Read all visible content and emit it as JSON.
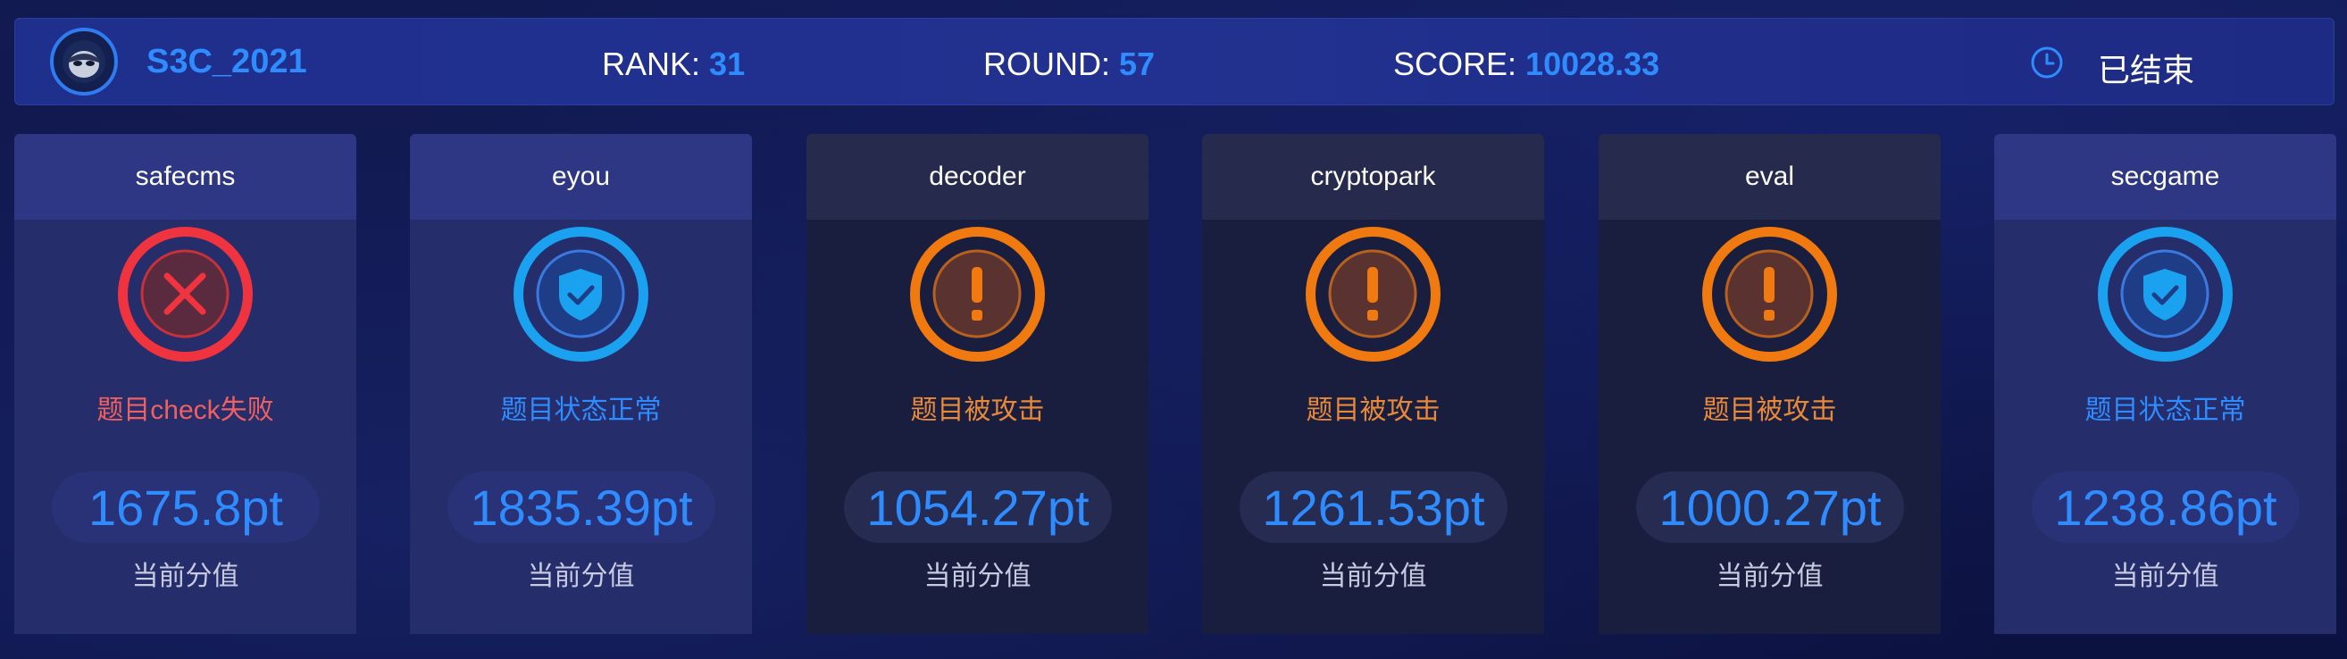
{
  "header": {
    "team_name": "S3C_2021",
    "rank_label": "RANK:",
    "rank_value": "31",
    "round_label": "ROUND:",
    "round_value": "57",
    "score_label": "SCORE:",
    "score_value": "10028.33",
    "status_icon": "clock-icon",
    "status_text": "已结束"
  },
  "score_caption": "当前分值",
  "colors": {
    "accent": "#2f8cff",
    "failed": "#f0343f",
    "normal": "#1aa2f0",
    "attacked": "#f07a10"
  },
  "cards": [
    {
      "name": "safecms",
      "state": "failed",
      "icon": "x-icon",
      "status": "题目check失败",
      "score": "1675.8pt"
    },
    {
      "name": "eyou",
      "state": "normal",
      "icon": "shield-check-icon",
      "status": "题目状态正常",
      "score": "1835.39pt"
    },
    {
      "name": "decoder",
      "state": "attacked",
      "icon": "exclamation-icon",
      "status": "题目被攻击",
      "score": "1054.27pt"
    },
    {
      "name": "cryptopark",
      "state": "attacked",
      "icon": "exclamation-icon",
      "status": "题目被攻击",
      "score": "1261.53pt"
    },
    {
      "name": "eval",
      "state": "attacked",
      "icon": "exclamation-icon",
      "status": "题目被攻击",
      "score": "1000.27pt"
    },
    {
      "name": "secgame",
      "state": "normal",
      "icon": "shield-check-icon",
      "status": "题目状态正常",
      "score": "1238.86pt"
    }
  ]
}
